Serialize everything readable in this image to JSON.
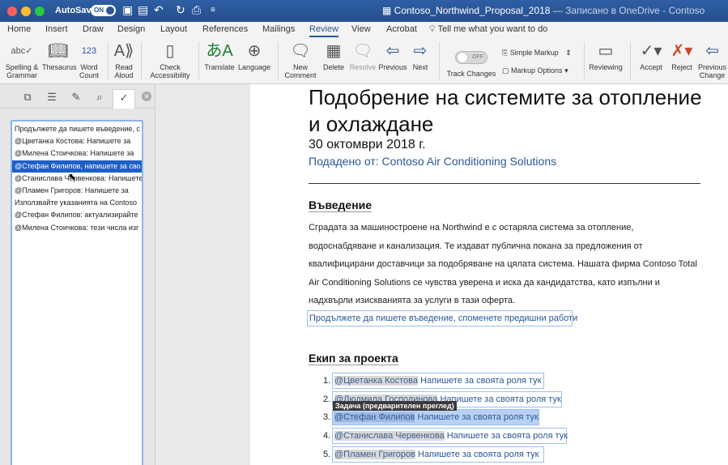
{
  "window": {
    "autosave_label": "AutoSave",
    "autosave_state": "ON",
    "doc_name": "Contoso_Northwind_Proposal_2018",
    "doc_status": "— Записано в OneDrive - Contoso"
  },
  "tabs": [
    "Home",
    "Insert",
    "Draw",
    "Design",
    "Layout",
    "References",
    "Mailings",
    "Review",
    "View",
    "Acrobat"
  ],
  "active_tab": "Review",
  "tell_me": "Tell me what you want to do",
  "ribbon": {
    "spelling": "Spelling & Grammar",
    "thesaurus": "Thesaurus",
    "word_count": "Word Count",
    "read_aloud": "Read Aloud",
    "check_access": "Check Accessibility",
    "translate": "Translate",
    "language": "Language",
    "new_comment": "New Comment",
    "delete": "Delete",
    "resolve": "Resolve",
    "previous": "Previous",
    "next": "Next",
    "track_state": "OFF",
    "track_changes": "Track Changes",
    "simple_markup": "Simple Markup",
    "markup_options": "Markup Options",
    "reviewing": "Reviewing",
    "accept": "Accept",
    "reject": "Reject",
    "previous_change": "Previous Change"
  },
  "nav_items": [
    "Продължете да пишете въведение, с",
    "@Цветанка Костова: Напишете за",
    "@Милена Стоичкова: Напишете за",
    "@Стефан Филипов, напишете за сво",
    "@Станислава Червенкова: Напишете",
    "@Пламен Григоров: Напишете за",
    "Използвайте указанията на Contoso",
    "@Стефан Филипов: актуализирайте",
    "@Милена Стоичкова: тези числа изг"
  ],
  "selected_nav_index": 3,
  "document": {
    "title": "Подобрение на системите за отопление и охлаждане",
    "date": "30 октомври 2018 г.",
    "submitted_by": "Подадено от: Contoso Air Conditioning Solutions",
    "intro_heading": "Въведение",
    "intro_text": "Сградата за машиностроене на Northwind е с остаряла система за отопление, водоснабдяване и канализация. Те издават публична покана за предложения от квалифицирани доставчици за подобряване на цялата система. Нашата фирма Contoso Total Air Conditioning Solutions се чувства уверена и иска да кандидатства, като изпълни и надхвърли изискванията за услуги в тази оферта.",
    "intro_placeholder": "Продължете да пишете въведение, споменете предишни работи",
    "team_heading": "Екип за проекта",
    "team": [
      {
        "num": "1.",
        "mention": "@Цветанка Костова",
        "text": " Напишете за своята роля тук"
      },
      {
        "num": "2.",
        "mention": "@Людмила Господинова",
        "text": " Напишете за своята роля тук"
      },
      {
        "num": "3.",
        "mention": "@Стефан Филипов",
        "text": " Напишете за своята роля тук"
      },
      {
        "num": "4.",
        "mention": "@Станислава Червенкова",
        "text": " Напишете за своята роля тук"
      },
      {
        "num": "5.",
        "mention": "@Пламен Григоров",
        "text": " Напишете за своята роля тук"
      }
    ],
    "tooltip": "Задача (предварителен преглед)"
  }
}
